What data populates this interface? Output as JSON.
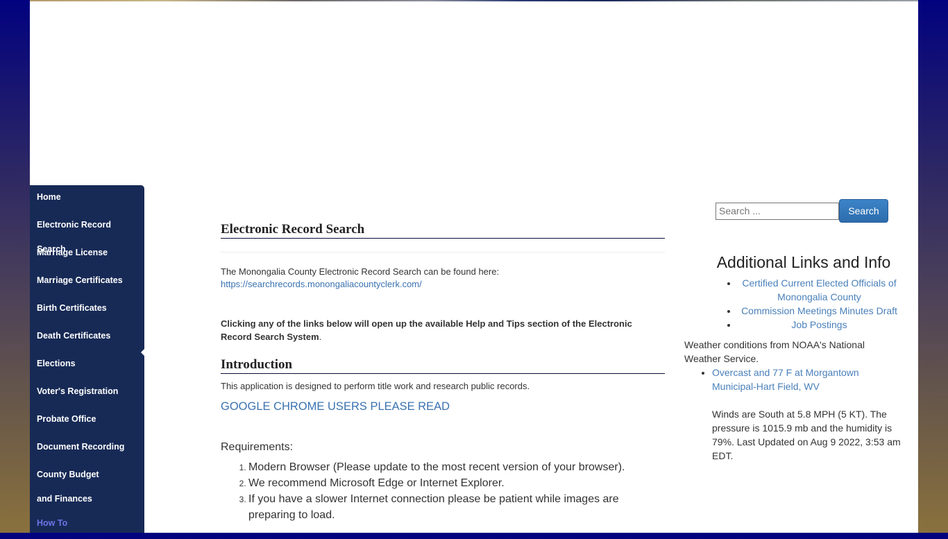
{
  "sidebar": {
    "items": [
      {
        "label": "Home"
      },
      {
        "label": "Electronic Record Search"
      },
      {
        "label": "Marriage License"
      },
      {
        "label": "Marriage Certificates"
      },
      {
        "label": "Birth Certificates"
      },
      {
        "label": "Death Certificates"
      },
      {
        "label": "Elections"
      },
      {
        "label": "Voter's Registration"
      },
      {
        "label": "Probate Office"
      },
      {
        "label": "Document Recording"
      },
      {
        "label": "County Budget and Finances"
      },
      {
        "label": "How To"
      }
    ]
  },
  "main": {
    "title": "Electronic Record Search",
    "intro_text": "The Monongalia County Electronic Record Search can be found here:",
    "intro_link": "https://searchrecords.monongaliacountyclerk.com/",
    "help_text": "Clicking any of the links below will open up the available Help and Tips section of the Electronic Record Search System",
    "help_period": ".",
    "introduction_heading": "Introduction",
    "introduction_text": "This application is designed to perform title work and research public records.",
    "chrome_link": "GOOGLE CHROME USERS PLEASE READ",
    "requirements_label": "Requirements:",
    "requirements": [
      "Modern Browser (Please update to the most recent version of your browser).",
      "We recommend Microsoft Edge or Internet Explorer.",
      "If you have a slower Internet connection please be patient while images are preparing to load."
    ]
  },
  "search": {
    "placeholder": "Search ...",
    "button_label": "Search"
  },
  "right_sidebar": {
    "heading": "Additional Links and Info",
    "links": [
      {
        "label": "Certified Current Elected Officials of Monongalia County"
      },
      {
        "label": "Commission Meetings Minutes Draft"
      },
      {
        "label": "Job Postings"
      }
    ],
    "weather_intro": "Weather conditions from NOAA's National Weather Service.",
    "weather_link": "Overcast and 77 F at Morgantown Municipal-Hart Field, WV",
    "weather_detail": "Winds are South at 5.8 MPH (5 KT). The pressure is 1015.9 mb and the humidity is 79%. Last Updated on Aug 9 2022, 3:53 am EDT."
  }
}
